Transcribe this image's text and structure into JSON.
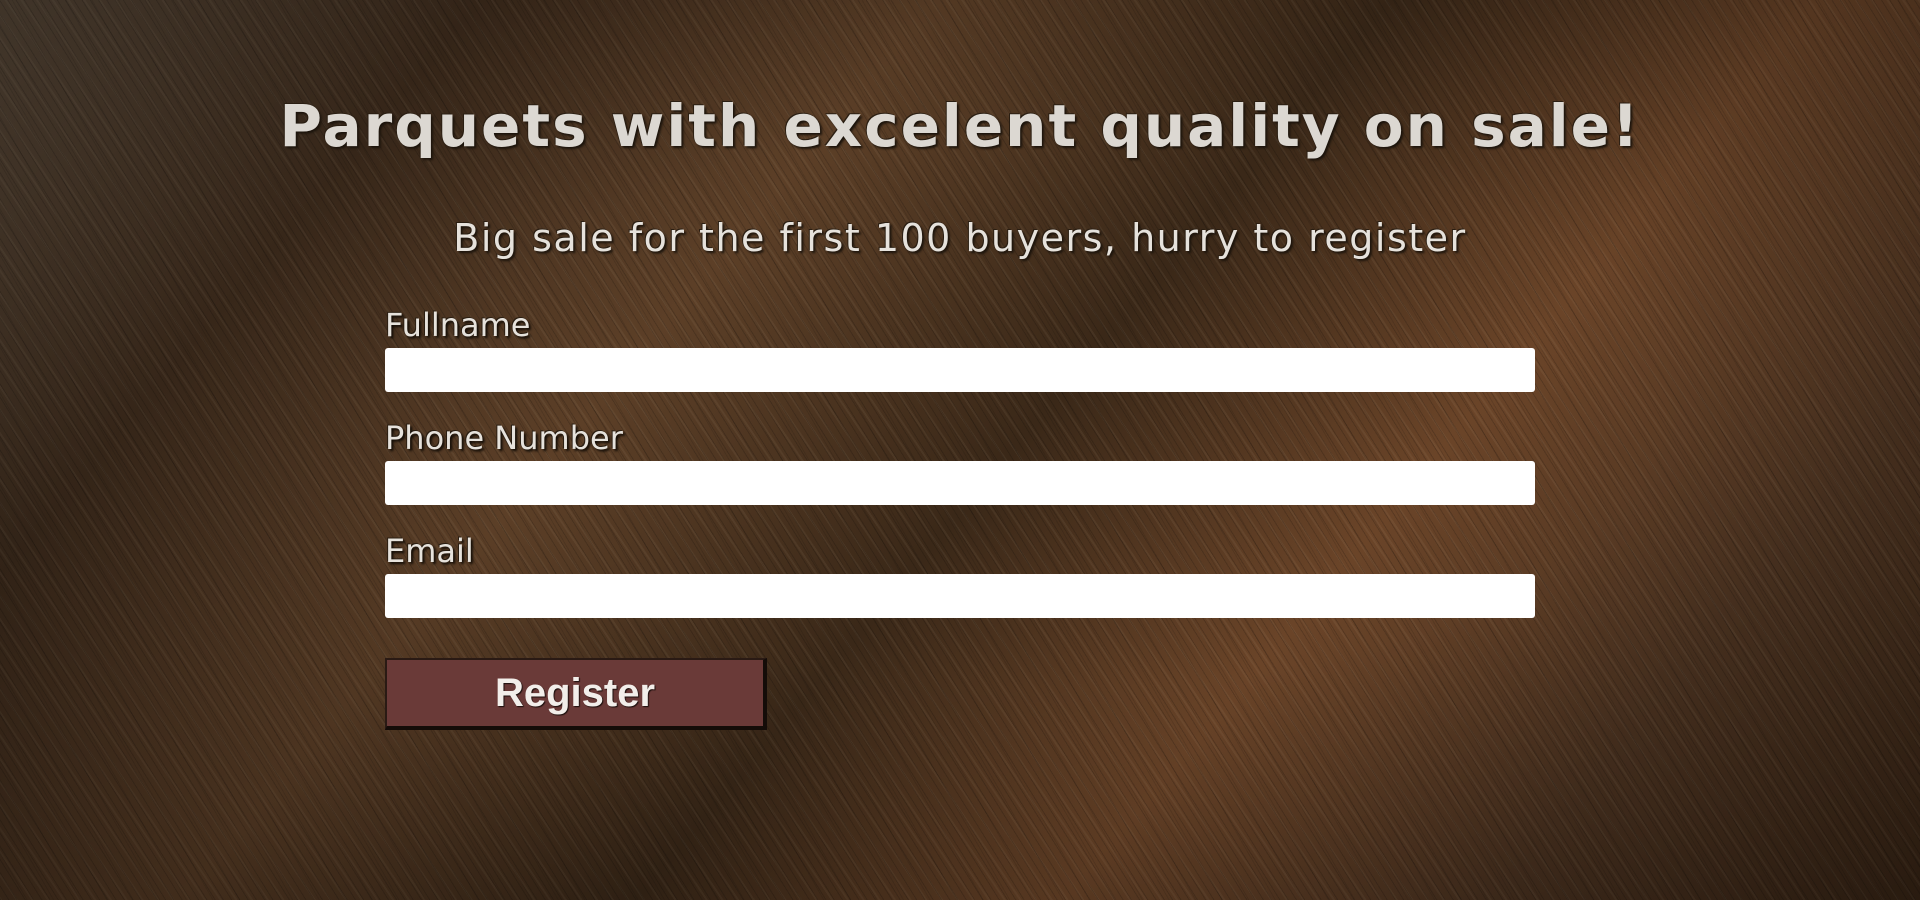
{
  "header": {
    "title": "Parquets with excelent quality on sale!",
    "subtitle": "Big sale for the first 100 buyers, hurry to register"
  },
  "form": {
    "fields": [
      {
        "label": "Fullname",
        "value": "",
        "placeholder": ""
      },
      {
        "label": "Phone Number",
        "value": "",
        "placeholder": ""
      },
      {
        "label": "Email",
        "value": "",
        "placeholder": ""
      }
    ],
    "submit_label": "Register"
  },
  "colors": {
    "button_background": "#6a3a38",
    "text": "#e6e2dc",
    "input_background": "#ffffff"
  }
}
